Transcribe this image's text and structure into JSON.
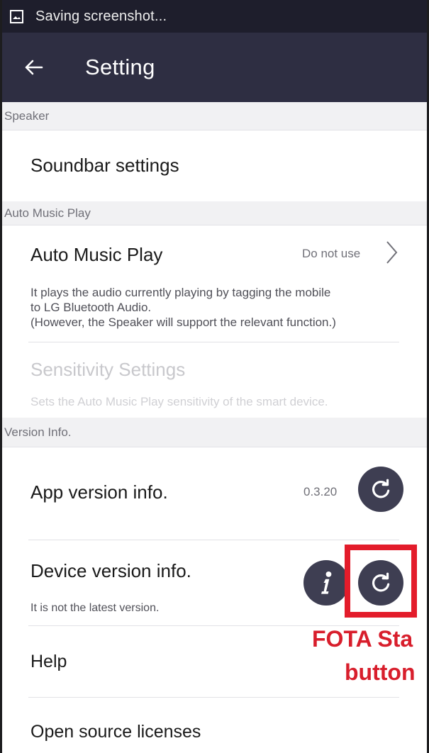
{
  "status_bar": {
    "text": "Saving screenshot..."
  },
  "app_bar": {
    "title": "Setting"
  },
  "sections": {
    "speaker": "Speaker",
    "auto_music_play": "Auto Music Play",
    "version_info": "Version Info."
  },
  "rows": {
    "soundbar_settings": "Soundbar settings",
    "auto_music_play": {
      "title": "Auto Music Play",
      "value": "Do not use",
      "desc_line1": "It plays the audio currently playing by tagging the mobile",
      "desc_line2": "to LG Bluetooth Audio.",
      "desc_line3": "(However, the Speaker will support the relevant function.)"
    },
    "sensitivity": {
      "title": "Sensitivity Settings",
      "desc": "Sets the Auto Music Play sensitivity of the smart device."
    },
    "app_version": {
      "title": "App version info.",
      "value": "0.3.20"
    },
    "device_version": {
      "title": "Device version info.",
      "desc": "It is not the latest version."
    },
    "help": "Help",
    "open_source": "Open source licenses"
  },
  "annotation": {
    "line1": "FOTA Sta",
    "line2": "button",
    "color": "#d81e2c"
  },
  "icons": [
    "image-icon",
    "back-arrow-icon",
    "chevron-right-icon",
    "refresh-icon",
    "info-icon"
  ],
  "colors": {
    "status_bar": "#1e1e2c",
    "app_bar": "#2e2e42",
    "button": "#3e3e52",
    "highlight": "#e31c2b"
  }
}
